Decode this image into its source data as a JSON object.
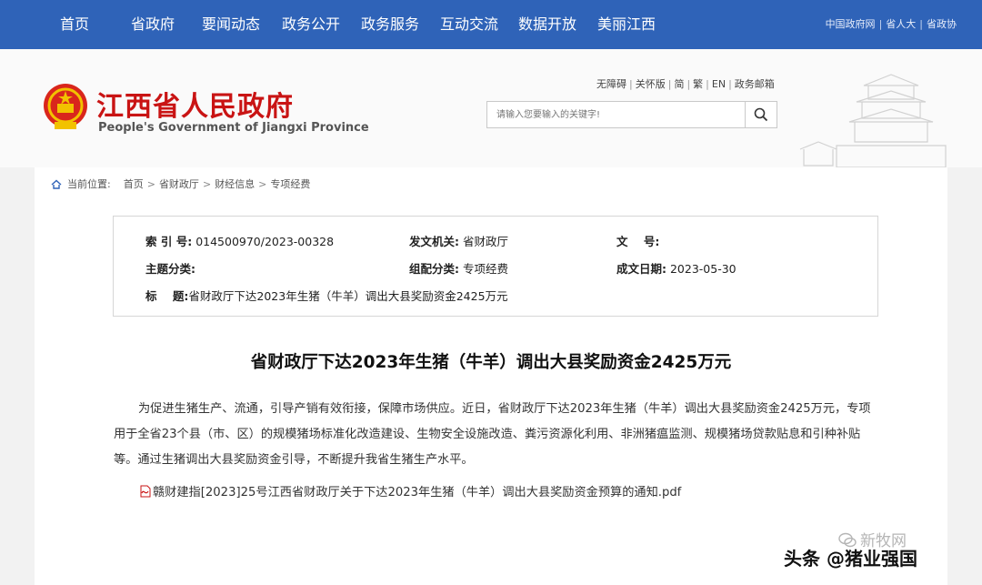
{
  "nav": {
    "items": [
      "首页",
      "省政府",
      "要闻动态",
      "政务公开",
      "政务服务",
      "互动交流",
      "数据开放",
      "美丽江西"
    ],
    "links": [
      "中国政府网",
      "省人大",
      "省政协"
    ]
  },
  "header": {
    "title_cn": "江西省人民政府",
    "title_en": "People's Government of Jiangxi Province",
    "utils": [
      "无障碍",
      "关怀版",
      "简",
      "繁",
      "EN",
      "政务邮箱"
    ],
    "search_placeholder": "请输入您要输入的关键字!"
  },
  "breadcrumb": {
    "label": "当前位置:",
    "items": [
      "首页",
      "省财政厅",
      "财经信息",
      "专项经费"
    ]
  },
  "info": {
    "index_key": "索 引 号:",
    "index_val": "014500970/2023-00328",
    "issuer_key": "发文机关:",
    "issuer_val": "省财政厅",
    "docno_key": "文    号:",
    "docno_val": "",
    "topic_key": "主题分类:",
    "topic_val": "",
    "group_key": "组配分类:",
    "group_val": "专项经费",
    "date_key": "成文日期:",
    "date_val": "2023-05-30",
    "title_key": "标    题:",
    "title_val": "省财政厅下达2023年生猪（牛羊）调出大县奖励资金2425万元"
  },
  "article": {
    "title": "省财政厅下达2023年生猪（牛羊）调出大县奖励资金2425万元",
    "body": "为促进生猪生产、流通，引导产销有效衔接，保障市场供应。近日，省财政厅下达2023年生猪（牛羊）调出大县奖励资金2425万元，专项用于全省23个县（市、区）的规模猪场标准化改造建设、生物安全设施改造、粪污资源化利用、非洲猪瘟监测、规模猪场贷款贴息和引种补贴等。通过生猪调出大县奖励资金引导，不断提升我省生猪生产水平。",
    "attachment": "赣财建指[2023]25号江西省财政厅关于下达2023年生猪（牛羊）调出大县奖励资金预算的通知.pdf"
  },
  "watermark": {
    "line1": "新牧网",
    "line2": "头条 @猪业强国"
  },
  "colors": {
    "nav_bg": "#2f63b8",
    "title_red": "#c91414",
    "page_bg": "#f2f2f2"
  }
}
